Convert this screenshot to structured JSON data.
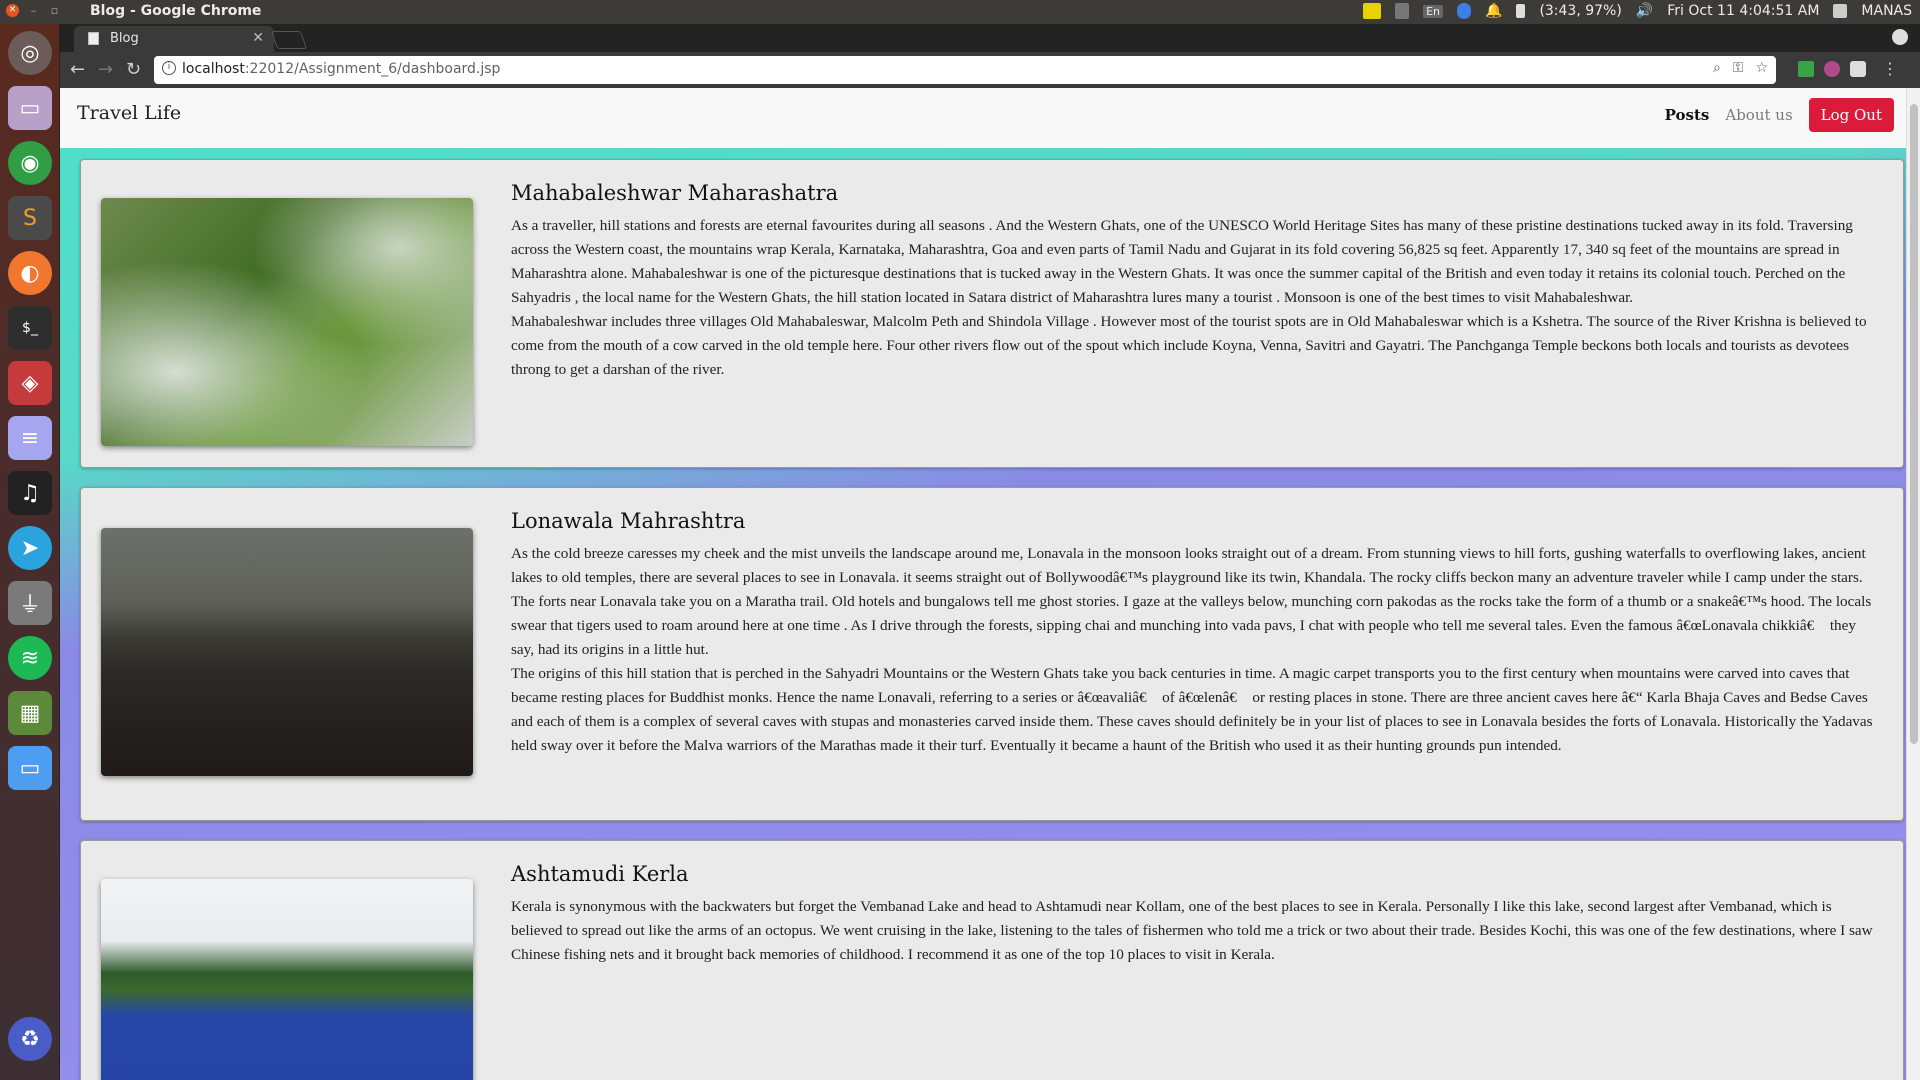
{
  "system": {
    "window_title": "Blog - Google Chrome",
    "battery": "(3:43, 97%)",
    "keyboard": "En",
    "datetime": "Fri Oct 11  4:04:51 AM",
    "user": "MANAS"
  },
  "browser": {
    "tab_title": "Blog",
    "url_host": "localhost",
    "url_path": ":22012/Assignment_6/dashboard.jsp"
  },
  "site": {
    "brand": "Travel Life",
    "nav": {
      "posts": "Posts",
      "about": "About us",
      "logout": "Log Out"
    }
  },
  "posts": [
    {
      "title": "Mahabaleshwar Maharashatra",
      "paragraphs": [
        "As a traveller, hill stations and forests are eternal favourites during all seasons . And the Western Ghats, one of the UNESCO World Heritage Sites has many of these pristine destinations tucked away in its fold. Traversing across the Western coast, the mountains wrap Kerala, Karnataka, Maharashtra, Goa and even parts of Tamil Nadu and Gujarat in its fold covering 56,825 sq feet. Apparently 17, 340 sq feet of the mountains are spread in Maharashtra alone. Mahabaleshwar is one of the picturesque destinations that is tucked away in the Western Ghats. It was once the summer capital of the British and even today it retains its colonial touch. Perched on the Sahyadris , the local name for the Western Ghats, the hill station located in Satara district of Maharashtra lures many a tourist . Monsoon is one of the best times to visit Mahabaleshwar.",
        "Mahabaleshwar includes three villages Old Mahabaleswar, Malcolm Peth and Shindola Village . However most of the tourist spots are in Old Mahabaleswar which is a Kshetra. The source of the River Krishna is believed to come from the mouth of a cow carved in the old temple here. Four other rivers flow out of the spout which include Koyna, Venna, Savitri and Gayatri. The Panchganga Temple beckons both locals and tourists as devotees throng to get a darshan of the river."
      ]
    },
    {
      "title": "Lonawala Mahrashtra",
      "paragraphs": [
        "As the cold breeze caresses my cheek and the mist unveils the landscape around me, Lonavala in the monsoon looks straight out of a dream. From stunning views to hill forts, gushing waterfalls to overflowing lakes, ancient lakes to old temples, there are several places to see in Lonavala. it seems straight out of Bollywoodâ€™s playground like its twin, Khandala. The rocky cliffs beckon many an adventure traveler while I camp under the stars. The forts near Lonavala take you on a Maratha trail. Old hotels and bungalows tell me ghost stories. I gaze at the valleys below, munching corn pakodas as the rocks take the form of a thumb or a snakeâ€™s hood. The locals swear that tigers used to roam around here at one time . As I drive through the forests, sipping chai and munching into vada pavs, I chat with people who tell me several tales. Even the famous â€œLonavala chikkiâ€\u0000 they say, had its origins in a little hut.",
        "The origins of this hill station that is perched in the Sahyadri Mountains or the Western Ghats take you back centuries in time. A magic carpet transports you to the first century when mountains were carved into caves that became resting places for Buddhist monks. Hence the name Lonavali, referring to a series or â€œavaliâ€\u0000 of â€œlenâ€\u0000 or resting places in stone. There are three ancient caves here â€“ Karla Bhaja Caves and Bedse Caves and each of them is a complex of several caves with stupas and monasteries carved inside them. These caves should definitely be in your list of places to see in Lonavala besides the forts of Lonavala. Historically the Yadavas held sway over it before the Malva warriors of the Marathas made it their turf. Eventually it became a haunt of the British who used it as their hunting grounds pun intended."
      ]
    },
    {
      "title": "Ashtamudi Kerla",
      "paragraphs": [
        "Kerala is synonymous with the backwaters but forget the Vembanad Lake and head to Ashtamudi near Kollam, one of the best places to see in Kerala. Personally I like this lake, second largest after Vembanad, which is believed to spread out like the arms of an octopus. We went cruising in the lake, listening to the tales of fishermen who told me a trick or two about their trade. Besides Kochi, this was one of the few destinations, where I saw Chinese fishing nets and it brought back memories of childhood. I recommend it as one of the top 10 places to visit in Kerala."
      ]
    }
  ]
}
